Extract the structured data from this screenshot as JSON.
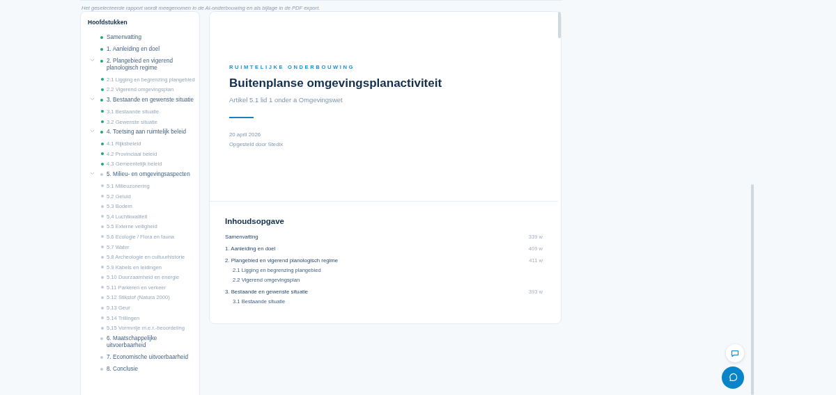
{
  "note": "Het geselecteerde rapport wordt meegenomen in de AI-onderbouwing en als bijlage in de PDF export.",
  "sidebar": {
    "title": "Hoofdstukken",
    "items": [
      {
        "label": "Samenvatting",
        "color": "#1aa876"
      },
      {
        "label": "1. Aanleiding en doel",
        "color": "#1aa876"
      },
      {
        "label": "2. Plangebied en vigerend planologisch regime",
        "color": "#1aa876",
        "expanded": true,
        "children": [
          {
            "label": "2.1 Ligging en begrenzing plangebied",
            "color": "#1aa876"
          },
          {
            "label": "2.2 Vigerend omgevingsplan",
            "color": "#1aa876"
          }
        ]
      },
      {
        "label": "3. Bestaande en gewenste situatie",
        "color": "#1aa876",
        "expanded": true,
        "children": [
          {
            "label": "3.1 Bestaande situatie",
            "color": "#1aa876"
          },
          {
            "label": "3.2 Gewenste situatie",
            "color": "#1aa876"
          }
        ]
      },
      {
        "label": "4. Toetsing aan ruimtelijk beleid",
        "color": "#1aa876",
        "expanded": true,
        "children": [
          {
            "label": "4.1 Rijksbeleid",
            "color": "#1aa876"
          },
          {
            "label": "4.2 Provinciaal beleid",
            "color": "#1aa876"
          },
          {
            "label": "4.3 Gemeentelijk beleid",
            "color": "#1aa876"
          }
        ]
      },
      {
        "label": "5. Milieu- en omgevingsaspecten",
        "color": "#c3ccd6",
        "expanded": true,
        "children": [
          {
            "label": "5.1 Milieuzonering",
            "color": "#c3ccd6"
          },
          {
            "label": "5.2 Geluid",
            "color": "#c3ccd6"
          },
          {
            "label": "5.3 Bodem",
            "color": "#c3ccd6"
          },
          {
            "label": "5.4 Luchtkwaliteit",
            "color": "#c3ccd6"
          },
          {
            "label": "5.5 Externe veiligheid",
            "color": "#c3ccd6"
          },
          {
            "label": "5.6 Ecologie / Flora en fauna",
            "color": "#c3ccd6"
          },
          {
            "label": "5.7 Water",
            "color": "#c3ccd6"
          },
          {
            "label": "5.8 Archeologie en cultuurhistorie",
            "color": "#c3ccd6"
          },
          {
            "label": "5.9 Kabels en leidingen",
            "color": "#c3ccd6"
          },
          {
            "label": "5.10 Duurzaamheid en energie",
            "color": "#c3ccd6"
          },
          {
            "label": "5.11 Parkeren en verkeer",
            "color": "#c3ccd6"
          },
          {
            "label": "5.12 Stikstof (Natura 2000)",
            "color": "#c3ccd6"
          },
          {
            "label": "5.13 Geur",
            "color": "#c3ccd6"
          },
          {
            "label": "5.14 Trillingen",
            "color": "#c3ccd6"
          },
          {
            "label": "5.15 Vormvrije m.e.r.-beoordeling",
            "color": "#c3ccd6"
          }
        ]
      },
      {
        "label": "6. Maatschappelijke uitvoerbaarheid",
        "color": "#c3ccd6"
      },
      {
        "label": "7. Economische uitvoerbaarheid",
        "color": "#c3ccd6"
      },
      {
        "label": "8. Conclusie",
        "color": "#c3ccd6"
      }
    ]
  },
  "document": {
    "kicker": "RUIMTELIJKE ONDERBOUWING",
    "title": "Buitenplanse omgevingsplanactiviteit",
    "subtitle": "Artikel 5.1 lid 1 onder a Omgevingswet",
    "date": "20 april 2026",
    "author": "Opgesteld door Stedix",
    "toc": {
      "title": "Inhoudsopgave",
      "entries": [
        {
          "label": "Samenvatting",
          "words": "339 w"
        },
        {
          "label": "1. Aanleiding en doel",
          "words": "409 w"
        },
        {
          "label": "2. Plangebied en vigerend planologisch regime",
          "words": "411 w",
          "children": [
            {
              "label": "2.1 Ligging en begrenzing plangebied"
            },
            {
              "label": "2.2 Vigerend omgevingsplan"
            }
          ]
        },
        {
          "label": "3. Bestaande en gewenste situatie",
          "words": "393 w",
          "children": [
            {
              "label": "3.1 Bestaande situatie"
            }
          ]
        }
      ]
    }
  }
}
